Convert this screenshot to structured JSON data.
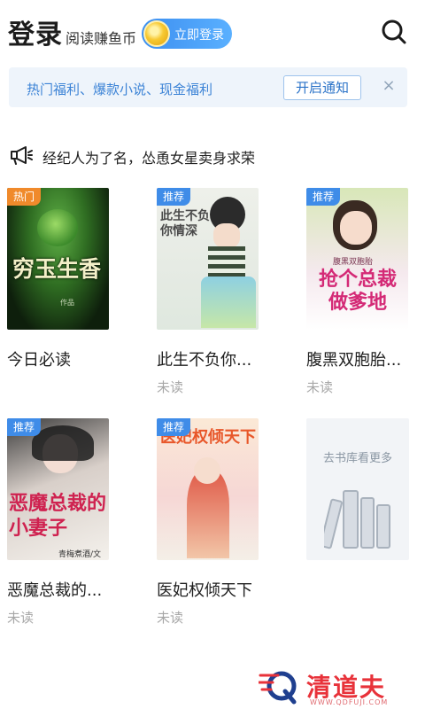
{
  "header": {
    "title": "登录",
    "subtitle": "阅读赚鱼币",
    "login_button": "立即登录",
    "search_icon": "search-icon"
  },
  "banner": {
    "text": "热门福利、爆款小说、现金福利",
    "button": "开启通知",
    "close": "×"
  },
  "announcement": {
    "icon": "megaphone-icon",
    "text": "经纪人为了名，怂恿女星卖身求荣"
  },
  "books": [
    {
      "badge": "热门",
      "badge_type": "hot",
      "title": "今日必读",
      "status": "",
      "cover_text": "穷玉生香",
      "cover_credit": "作品"
    },
    {
      "badge": "推荐",
      "badge_type": "rec",
      "title": "此生不负你...",
      "status": "未读",
      "cover_text": "此生不负你情深"
    },
    {
      "badge": "推荐",
      "badge_type": "rec",
      "title": "腹黑双胞胎...",
      "status": "未读",
      "cover_text": "抢个总裁做爹地",
      "cover_top": "腹黑双胞胎"
    },
    {
      "badge": "推荐",
      "badge_type": "rec",
      "title": "恶魔总裁的...",
      "status": "未读",
      "cover_text": "恶魔总裁的小妻子",
      "cover_credit": "青梅煮酒/文"
    },
    {
      "badge": "推荐",
      "badge_type": "rec",
      "title": "医妃权倾天下",
      "status": "未读",
      "cover_text": "医妃权倾天下"
    }
  ],
  "more": {
    "label": "去书库看更多"
  },
  "watermark": {
    "text": "清道夫",
    "url": "WWW.QDFUJI.COM"
  }
}
